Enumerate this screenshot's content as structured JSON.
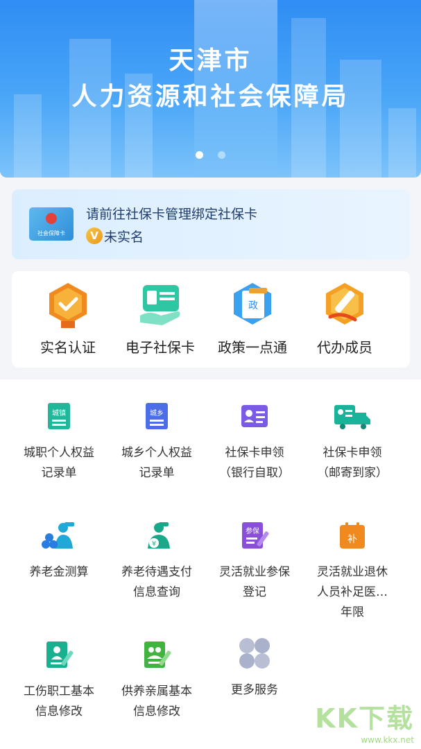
{
  "banner": {
    "line1": "天津市",
    "line2": "人力资源和社会保障局",
    "page_count": 2,
    "active_page": 1
  },
  "card_notice": {
    "card_label": "社会保障卡",
    "text": "请前往社保卡管理绑定社保卡",
    "badge": "V",
    "status": "未实名"
  },
  "quick_access": [
    {
      "label": "实名认证",
      "icon": "verify-badge-icon"
    },
    {
      "label": "电子社保卡",
      "icon": "e-social-card-icon"
    },
    {
      "label": "政策一点通",
      "icon": "policy-document-icon"
    },
    {
      "label": "代办成员",
      "icon": "agent-member-icon"
    }
  ],
  "services": [
    {
      "label_lines": [
        "城职个人权益",
        "记录单"
      ],
      "icon": "urban-worker-record-icon",
      "icon_text": "城镇"
    },
    {
      "label_lines": [
        "城乡个人权益",
        "记录单"
      ],
      "icon": "urban-rural-record-icon",
      "icon_text": "城乡"
    },
    {
      "label_lines": [
        "社保卡申领",
        "（银行自取）"
      ],
      "icon": "card-bank-pickup-icon"
    },
    {
      "label_lines": [
        "社保卡申领",
        "（邮寄到家）"
      ],
      "icon": "card-mail-delivery-icon"
    },
    {
      "label_lines": [
        "养老金测算"
      ],
      "icon": "pension-calculator-icon"
    },
    {
      "label_lines": [
        "养老待遇支付",
        "信息查询"
      ],
      "icon": "pension-payment-icon"
    },
    {
      "label_lines": [
        "灵活就业参保",
        "登记"
      ],
      "icon": "flexible-insurance-icon",
      "icon_text": "参保"
    },
    {
      "label_lines": [
        "灵活就业退休",
        "人员补足医…",
        "年限"
      ],
      "icon": "flexible-retiree-icon",
      "icon_text": "补"
    },
    {
      "label_lines": [
        "工伤职工基本",
        "信息修改"
      ],
      "icon": "injury-worker-edit-icon"
    },
    {
      "label_lines": [
        "供养亲属基本",
        "信息修改"
      ],
      "icon": "dependent-edit-icon"
    },
    {
      "label_lines": [
        "更多服务"
      ],
      "icon": "more-services-icon"
    }
  ],
  "watermark": {
    "big": "KK下载",
    "small": "www.kkx.net"
  },
  "colors": {
    "primary": "#2f8df4",
    "notice_text": "#1f3d70"
  }
}
